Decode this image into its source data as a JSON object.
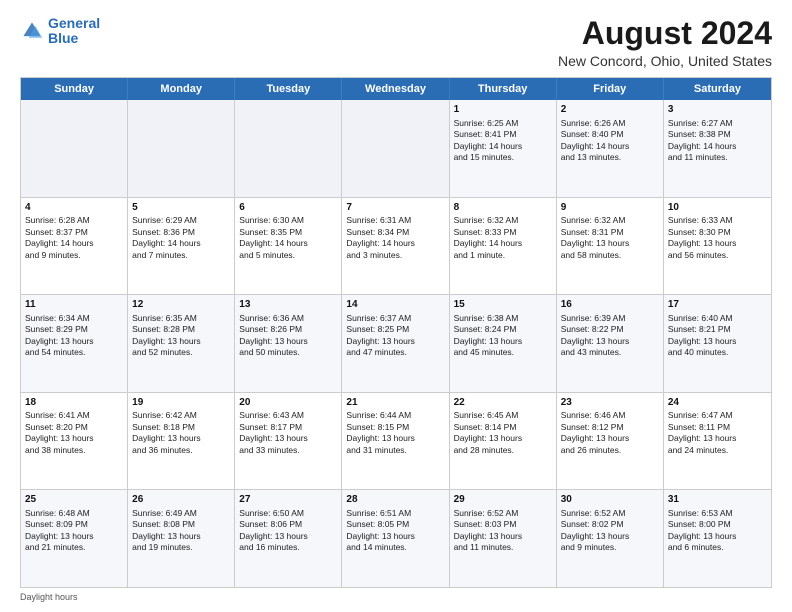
{
  "logo": {
    "line1": "General",
    "line2": "Blue"
  },
  "title": "August 2024",
  "subtitle": "New Concord, Ohio, United States",
  "days": [
    "Sunday",
    "Monday",
    "Tuesday",
    "Wednesday",
    "Thursday",
    "Friday",
    "Saturday"
  ],
  "footer": "Daylight hours",
  "weeks": [
    [
      {
        "day": "",
        "empty": true,
        "lines": []
      },
      {
        "day": "",
        "empty": true,
        "lines": []
      },
      {
        "day": "",
        "empty": true,
        "lines": []
      },
      {
        "day": "",
        "empty": true,
        "lines": []
      },
      {
        "day": "1",
        "empty": false,
        "lines": [
          "Sunrise: 6:25 AM",
          "Sunset: 8:41 PM",
          "Daylight: 14 hours",
          "and 15 minutes."
        ]
      },
      {
        "day": "2",
        "empty": false,
        "lines": [
          "Sunrise: 6:26 AM",
          "Sunset: 8:40 PM",
          "Daylight: 14 hours",
          "and 13 minutes."
        ]
      },
      {
        "day": "3",
        "empty": false,
        "lines": [
          "Sunrise: 6:27 AM",
          "Sunset: 8:38 PM",
          "Daylight: 14 hours",
          "and 11 minutes."
        ]
      }
    ],
    [
      {
        "day": "4",
        "empty": false,
        "lines": [
          "Sunrise: 6:28 AM",
          "Sunset: 8:37 PM",
          "Daylight: 14 hours",
          "and 9 minutes."
        ]
      },
      {
        "day": "5",
        "empty": false,
        "lines": [
          "Sunrise: 6:29 AM",
          "Sunset: 8:36 PM",
          "Daylight: 14 hours",
          "and 7 minutes."
        ]
      },
      {
        "day": "6",
        "empty": false,
        "lines": [
          "Sunrise: 6:30 AM",
          "Sunset: 8:35 PM",
          "Daylight: 14 hours",
          "and 5 minutes."
        ]
      },
      {
        "day": "7",
        "empty": false,
        "lines": [
          "Sunrise: 6:31 AM",
          "Sunset: 8:34 PM",
          "Daylight: 14 hours",
          "and 3 minutes."
        ]
      },
      {
        "day": "8",
        "empty": false,
        "lines": [
          "Sunrise: 6:32 AM",
          "Sunset: 8:33 PM",
          "Daylight: 14 hours",
          "and 1 minute."
        ]
      },
      {
        "day": "9",
        "empty": false,
        "lines": [
          "Sunrise: 6:32 AM",
          "Sunset: 8:31 PM",
          "Daylight: 13 hours",
          "and 58 minutes."
        ]
      },
      {
        "day": "10",
        "empty": false,
        "lines": [
          "Sunrise: 6:33 AM",
          "Sunset: 8:30 PM",
          "Daylight: 13 hours",
          "and 56 minutes."
        ]
      }
    ],
    [
      {
        "day": "11",
        "empty": false,
        "lines": [
          "Sunrise: 6:34 AM",
          "Sunset: 8:29 PM",
          "Daylight: 13 hours",
          "and 54 minutes."
        ]
      },
      {
        "day": "12",
        "empty": false,
        "lines": [
          "Sunrise: 6:35 AM",
          "Sunset: 8:28 PM",
          "Daylight: 13 hours",
          "and 52 minutes."
        ]
      },
      {
        "day": "13",
        "empty": false,
        "lines": [
          "Sunrise: 6:36 AM",
          "Sunset: 8:26 PM",
          "Daylight: 13 hours",
          "and 50 minutes."
        ]
      },
      {
        "day": "14",
        "empty": false,
        "lines": [
          "Sunrise: 6:37 AM",
          "Sunset: 8:25 PM",
          "Daylight: 13 hours",
          "and 47 minutes."
        ]
      },
      {
        "day": "15",
        "empty": false,
        "lines": [
          "Sunrise: 6:38 AM",
          "Sunset: 8:24 PM",
          "Daylight: 13 hours",
          "and 45 minutes."
        ]
      },
      {
        "day": "16",
        "empty": false,
        "lines": [
          "Sunrise: 6:39 AM",
          "Sunset: 8:22 PM",
          "Daylight: 13 hours",
          "and 43 minutes."
        ]
      },
      {
        "day": "17",
        "empty": false,
        "lines": [
          "Sunrise: 6:40 AM",
          "Sunset: 8:21 PM",
          "Daylight: 13 hours",
          "and 40 minutes."
        ]
      }
    ],
    [
      {
        "day": "18",
        "empty": false,
        "lines": [
          "Sunrise: 6:41 AM",
          "Sunset: 8:20 PM",
          "Daylight: 13 hours",
          "and 38 minutes."
        ]
      },
      {
        "day": "19",
        "empty": false,
        "lines": [
          "Sunrise: 6:42 AM",
          "Sunset: 8:18 PM",
          "Daylight: 13 hours",
          "and 36 minutes."
        ]
      },
      {
        "day": "20",
        "empty": false,
        "lines": [
          "Sunrise: 6:43 AM",
          "Sunset: 8:17 PM",
          "Daylight: 13 hours",
          "and 33 minutes."
        ]
      },
      {
        "day": "21",
        "empty": false,
        "lines": [
          "Sunrise: 6:44 AM",
          "Sunset: 8:15 PM",
          "Daylight: 13 hours",
          "and 31 minutes."
        ]
      },
      {
        "day": "22",
        "empty": false,
        "lines": [
          "Sunrise: 6:45 AM",
          "Sunset: 8:14 PM",
          "Daylight: 13 hours",
          "and 28 minutes."
        ]
      },
      {
        "day": "23",
        "empty": false,
        "lines": [
          "Sunrise: 6:46 AM",
          "Sunset: 8:12 PM",
          "Daylight: 13 hours",
          "and 26 minutes."
        ]
      },
      {
        "day": "24",
        "empty": false,
        "lines": [
          "Sunrise: 6:47 AM",
          "Sunset: 8:11 PM",
          "Daylight: 13 hours",
          "and 24 minutes."
        ]
      }
    ],
    [
      {
        "day": "25",
        "empty": false,
        "lines": [
          "Sunrise: 6:48 AM",
          "Sunset: 8:09 PM",
          "Daylight: 13 hours",
          "and 21 minutes."
        ]
      },
      {
        "day": "26",
        "empty": false,
        "lines": [
          "Sunrise: 6:49 AM",
          "Sunset: 8:08 PM",
          "Daylight: 13 hours",
          "and 19 minutes."
        ]
      },
      {
        "day": "27",
        "empty": false,
        "lines": [
          "Sunrise: 6:50 AM",
          "Sunset: 8:06 PM",
          "Daylight: 13 hours",
          "and 16 minutes."
        ]
      },
      {
        "day": "28",
        "empty": false,
        "lines": [
          "Sunrise: 6:51 AM",
          "Sunset: 8:05 PM",
          "Daylight: 13 hours",
          "and 14 minutes."
        ]
      },
      {
        "day": "29",
        "empty": false,
        "lines": [
          "Sunrise: 6:52 AM",
          "Sunset: 8:03 PM",
          "Daylight: 13 hours",
          "and 11 minutes."
        ]
      },
      {
        "day": "30",
        "empty": false,
        "lines": [
          "Sunrise: 6:52 AM",
          "Sunset: 8:02 PM",
          "Daylight: 13 hours",
          "and 9 minutes."
        ]
      },
      {
        "day": "31",
        "empty": false,
        "lines": [
          "Sunrise: 6:53 AM",
          "Sunset: 8:00 PM",
          "Daylight: 13 hours",
          "and 6 minutes."
        ]
      }
    ]
  ]
}
